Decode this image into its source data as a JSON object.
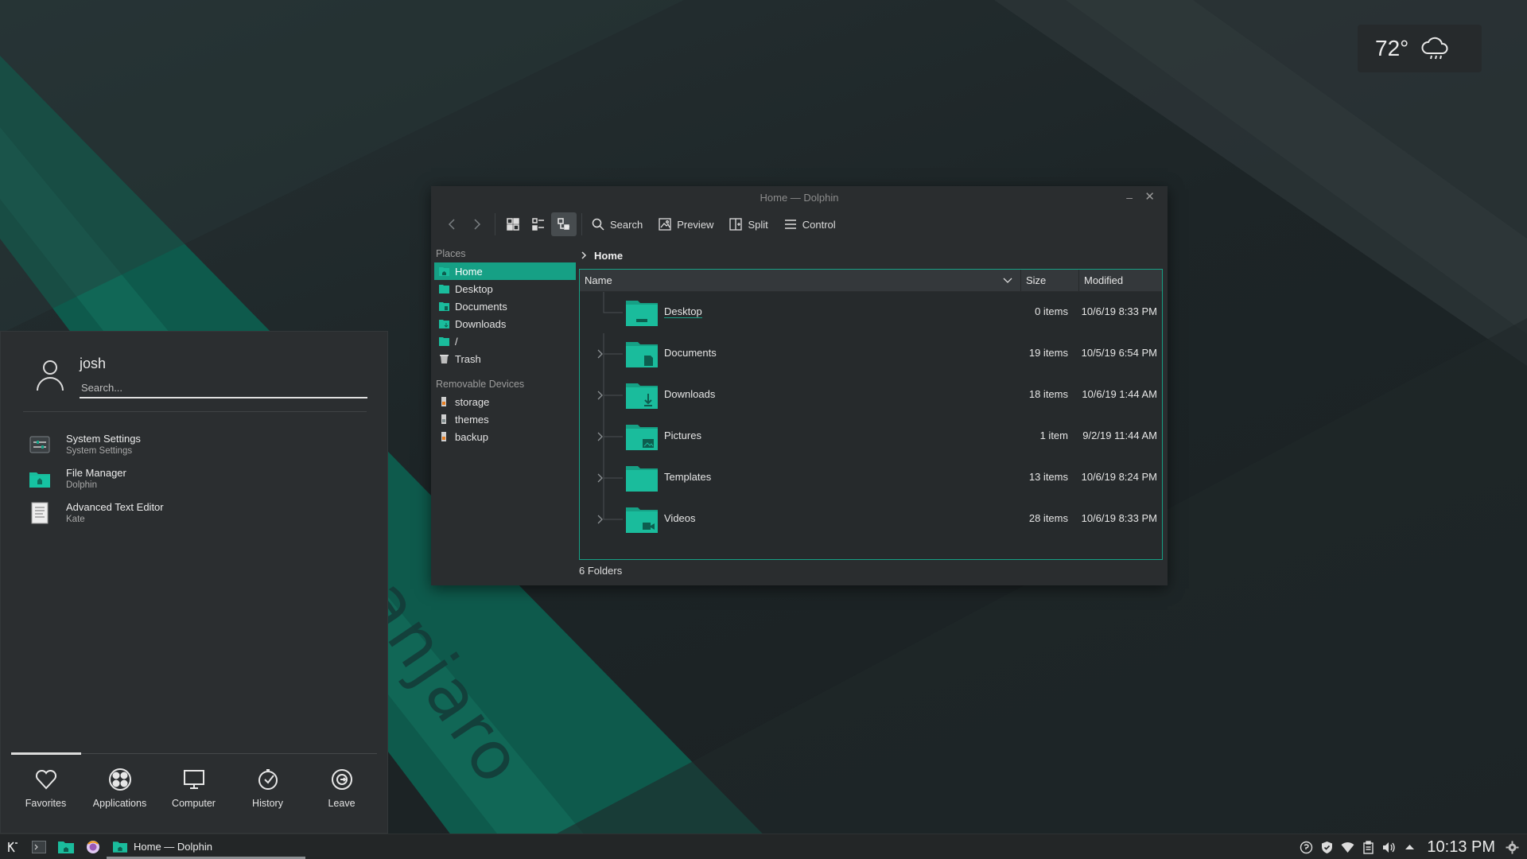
{
  "wallpaper": {
    "watermark": "manjaro"
  },
  "weather": {
    "temperature": "72°",
    "icon": "rain-cloud-icon"
  },
  "launcher": {
    "username": "josh",
    "search_placeholder": "Search...",
    "favorites": [
      {
        "title": "System Settings",
        "subtitle": "System Settings",
        "icon": "settings-icon"
      },
      {
        "title": "File Manager",
        "subtitle": "Dolphin",
        "icon": "folder-icon"
      },
      {
        "title": "Advanced Text Editor",
        "subtitle": "Kate",
        "icon": "text-editor-icon"
      }
    ],
    "tabs": [
      {
        "label": "Favorites",
        "icon": "heart-icon"
      },
      {
        "label": "Applications",
        "icon": "applications-icon"
      },
      {
        "label": "Computer",
        "icon": "computer-icon"
      },
      {
        "label": "History",
        "icon": "history-icon"
      },
      {
        "label": "Leave",
        "icon": "leave-icon"
      }
    ],
    "active_tab": "Favorites"
  },
  "dolphin": {
    "window_title": "Home — Dolphin",
    "toolbar": {
      "search": "Search",
      "preview": "Preview",
      "split": "Split",
      "control": "Control"
    },
    "places": {
      "header": "Places",
      "items": [
        "Home",
        "Desktop",
        "Documents",
        "Downloads",
        "/",
        "Trash"
      ],
      "selected": "Home"
    },
    "removable": {
      "header": "Removable Devices",
      "items": [
        "storage",
        "themes",
        "backup"
      ]
    },
    "breadcrumb": "Home",
    "columns": {
      "name": "Name",
      "size": "Size",
      "modified": "Modified"
    },
    "files": [
      {
        "name": "Desktop",
        "size": "0 items",
        "modified": "10/6/19 8:33 PM",
        "expandable": false
      },
      {
        "name": "Documents",
        "size": "19 items",
        "modified": "10/5/19 6:54 PM",
        "expandable": true
      },
      {
        "name": "Downloads",
        "size": "18 items",
        "modified": "10/6/19 1:44 AM",
        "expandable": true
      },
      {
        "name": "Pictures",
        "size": "1 item",
        "modified": "9/2/19 11:44 AM",
        "expandable": true
      },
      {
        "name": "Templates",
        "size": "13 items",
        "modified": "10/6/19 8:24 PM",
        "expandable": true
      },
      {
        "name": "Videos",
        "size": "28 items",
        "modified": "10/6/19 8:33 PM",
        "expandable": true
      }
    ],
    "status": "6 Folders"
  },
  "taskbar": {
    "task_label": "Home — Dolphin",
    "clock": "10:13 PM"
  },
  "colors": {
    "accent": "#16a085",
    "folder": "#1abc9c",
    "panel": "#2a2d2f"
  }
}
